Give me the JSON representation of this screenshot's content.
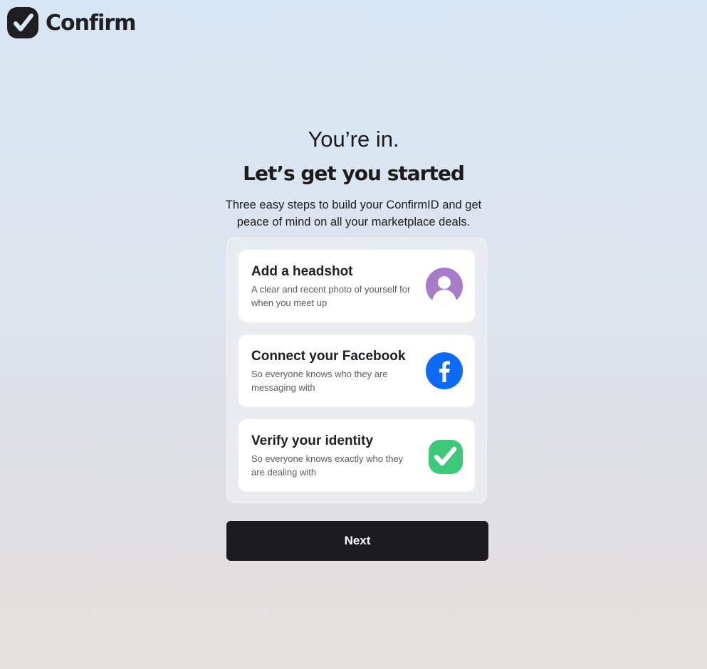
{
  "brand": {
    "name": "Confirm",
    "colors": {
      "dark": "#1f1f21",
      "purple": "#a67bc8",
      "facebook_blue": "#0c6af7",
      "green": "#3dc97a"
    }
  },
  "hero": {
    "title": "You’re in.",
    "subtitle": "Let’s get you started",
    "description": "Three easy steps to build your ConfirmID and get peace of mind on all your marketplace deals."
  },
  "steps": [
    {
      "title": "Add a headshot",
      "description": "A clear and recent photo of yourself for when you meet up",
      "icon": "user-avatar-icon"
    },
    {
      "title": "Connect your Facebook",
      "description": "So everyone knows who they are messaging with",
      "icon": "facebook-icon"
    },
    {
      "title": "Verify your identity",
      "description": "So everyone knows exactly who they are dealing with",
      "icon": "confirm-check-icon"
    }
  ],
  "actions": {
    "next_label": "Next"
  }
}
